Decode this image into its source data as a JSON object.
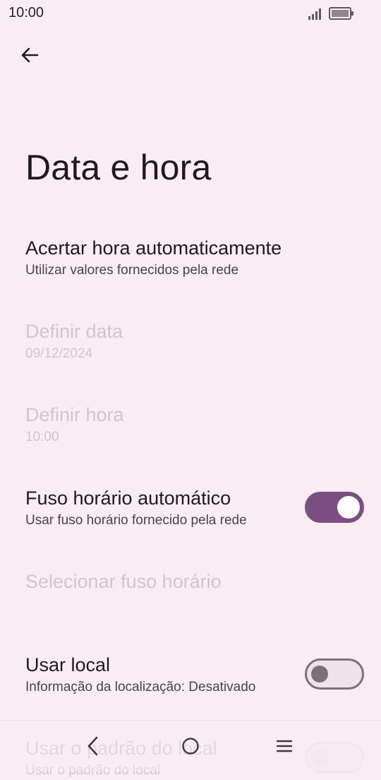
{
  "status_bar": {
    "time": "10:00"
  },
  "page": {
    "title": "Data e hora"
  },
  "settings": {
    "auto_time": {
      "title": "Acertar hora automaticamente",
      "summary": "Utilizar valores fornecidos pela rede"
    },
    "set_date": {
      "title": "Definir data",
      "summary": "09/12/2024"
    },
    "set_time": {
      "title": "Definir hora",
      "summary": "10:00"
    },
    "auto_timezone": {
      "title": "Fuso horário automático",
      "summary": "Usar fuso horário fornecido pela rede",
      "enabled": true
    },
    "select_timezone": {
      "title": "Selecionar fuso horário"
    },
    "use_locale": {
      "title": "Usar local",
      "summary": "Informação da localização: Desativado",
      "enabled": false
    },
    "use_locale_default": {
      "title": "Usar o padrão do local",
      "summary": "Usar o padrão do local",
      "enabled": false
    }
  },
  "colors": {
    "accent": "#7b4d80",
    "background": "#f9edf3"
  },
  "icons": {
    "back": "arrow-left-icon",
    "nav_back": "chevron-left-icon",
    "nav_home": "circle-home-icon",
    "nav_recents": "menu-icon"
  }
}
